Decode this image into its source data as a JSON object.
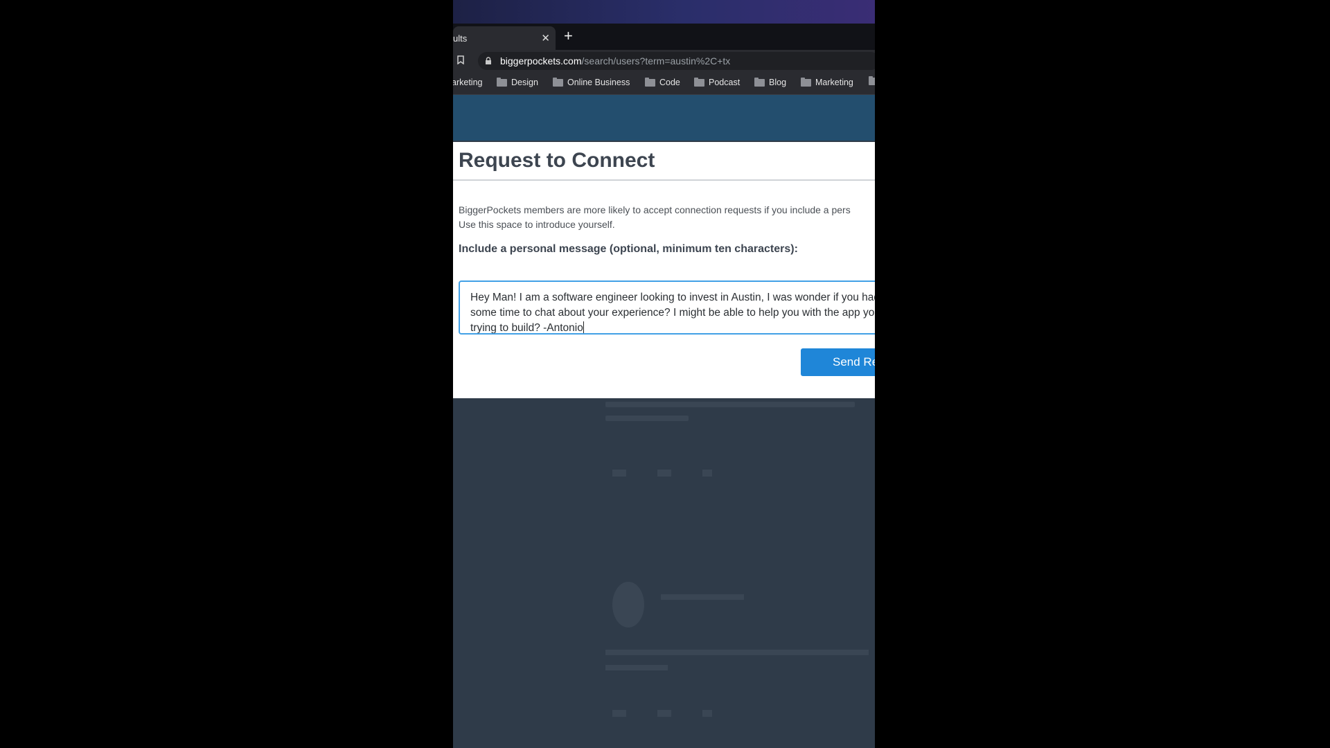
{
  "browser": {
    "tab_title": "ults",
    "tab_close": "✕",
    "new_tab": "+",
    "url_host": "biggerpockets.com",
    "url_path": "/search/users?term=austin%2C+tx",
    "bookmarks": [
      "arketing",
      "Design",
      "Online Business",
      "Code",
      "Podcast",
      "Blog",
      "Marketing"
    ]
  },
  "modal": {
    "title": "Request to Connect",
    "description_line1": "BiggerPockets members are more likely to accept connection requests if you include a pers",
    "description_line2": "Use this space to introduce yourself.",
    "label": "Include a personal message (optional, minimum ten characters):",
    "message": "Hey Man! I am a software engineer looking to invest in Austin, I was wonder if you had some time to chat about your experience? I might be able to help you with the app you are trying to build? -Antonio",
    "send_label": "Send Re"
  },
  "colors": {
    "accent": "#1f86d8",
    "focus_border": "#41a0e6",
    "overlay": "#2f3b49"
  }
}
